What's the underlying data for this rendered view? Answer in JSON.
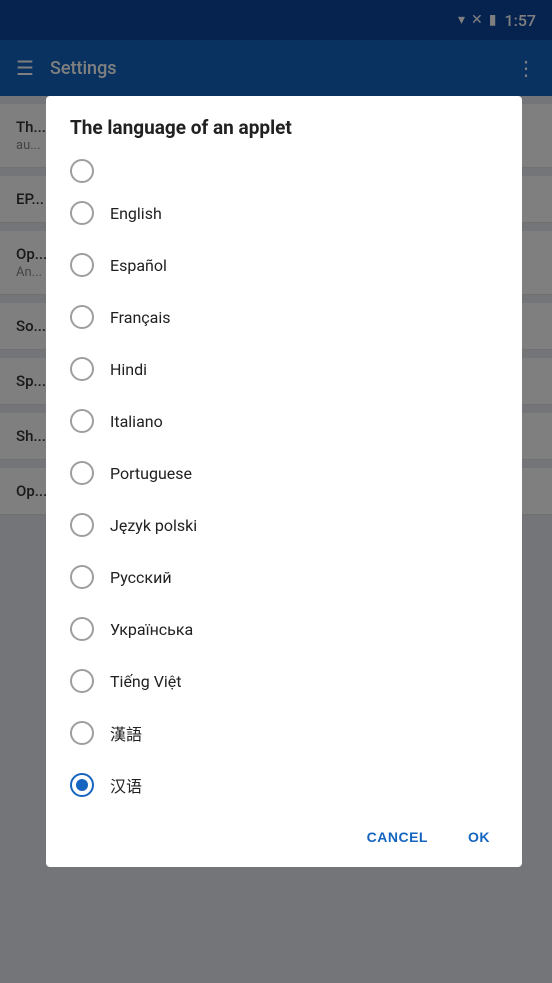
{
  "statusBar": {
    "time": "1:57"
  },
  "appBar": {
    "title": "Settings"
  },
  "dialog": {
    "title": "The language of an applet",
    "cancelLabel": "CANCEL",
    "okLabel": "OK",
    "languages": [
      {
        "label": "English",
        "selected": false
      },
      {
        "label": "Español",
        "selected": false
      },
      {
        "label": "Français",
        "selected": false
      },
      {
        "label": "Hindi",
        "selected": false
      },
      {
        "label": "Italiano",
        "selected": false
      },
      {
        "label": "Portuguese",
        "selected": false
      },
      {
        "label": "Język polski",
        "selected": false
      },
      {
        "label": "Русский",
        "selected": false
      },
      {
        "label": "Українська",
        "selected": false
      },
      {
        "label": "Tiếng Việt",
        "selected": false
      },
      {
        "label": "漢語",
        "selected": false
      },
      {
        "label": "汉语",
        "selected": true
      }
    ]
  },
  "backgroundItems": [
    {
      "title": "Th...",
      "subtitle": "au..."
    },
    {
      "title": "EP..."
    },
    {
      "title": "Op...",
      "subtitle": "An..."
    },
    {
      "title": "So..."
    },
    {
      "title": "Sp..."
    },
    {
      "title": "Sh..."
    },
    {
      "title": "Op..."
    }
  ],
  "icons": {
    "hamburger": "☰",
    "moreVert": "⋮",
    "wifi": "▼",
    "battery": "🔋",
    "noSim": "⊠"
  }
}
